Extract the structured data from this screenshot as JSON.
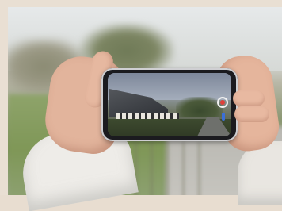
{
  "scene": {
    "description_label": "",
    "colors": {
      "border": "#e9dfd3",
      "sky": "#e6e9ea",
      "grass": "#8ea36a",
      "skin": "#e2b49c",
      "sleeve": "#eeece8",
      "phone_body": "#1b1b1f",
      "shutter_accent": "#e0403a"
    }
  },
  "phone": {
    "icons": [
      "shutter-button-icon"
    ]
  }
}
